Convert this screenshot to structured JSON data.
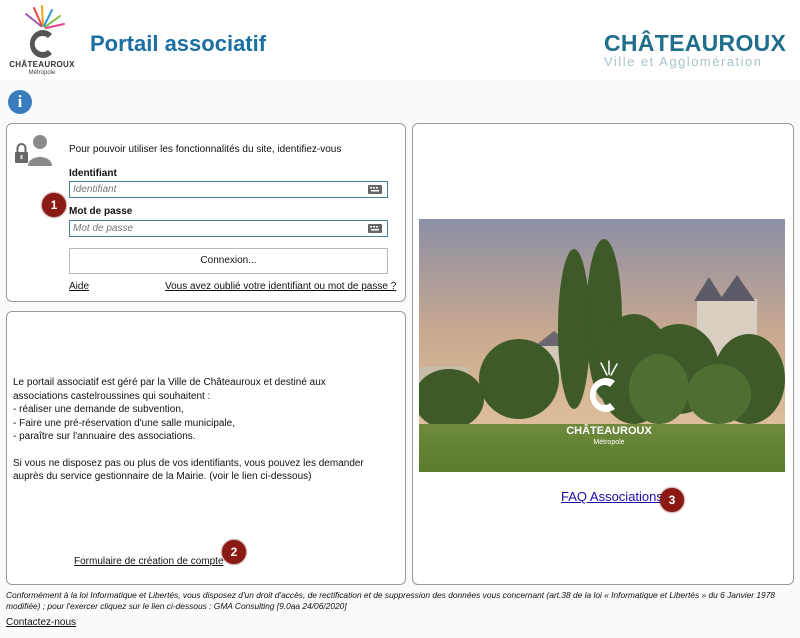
{
  "header": {
    "logo_text": "CHÂTEAUROUX",
    "logo_sub": "Métropole",
    "title": "Portail associatif",
    "brand": "CHÂTEAUROUX",
    "brand_sub": "Ville et Agglomération"
  },
  "info_icon": "i",
  "login": {
    "intro": "Pour pouvoir utiliser les fonctionnalités du site, identifiez-vous",
    "ident_label": "Identifiant",
    "ident_placeholder": "Identifiant",
    "pass_label": "Mot de passe",
    "pass_placeholder": "Mot de passe",
    "connect_label": "Connexion...",
    "help_label": "Aide",
    "forgot_label": "Vous avez oublié votre identifiant ou mot de passe ?"
  },
  "badges": [
    "1",
    "2",
    "3"
  ],
  "description": {
    "line1": "Le portail associatif est géré par la Ville de Châteauroux et destiné aux",
    "line2": "associations castelroussines qui souhaitent :",
    "line3": "- réaliser une demande de subvention,",
    "line4": "- Faire une pré-réservation d'une salle municipale,",
    "line5": "- paraître sur l'annuaire des associations.",
    "line6": "Si vous ne disposez pas ou plus de vos identifiants, vous pouvez les demander",
    "line7": "auprès du service gestionnaire de la Mairie. (voir le lien ci-dessous)"
  },
  "form_link": "Formulaire de création de compte",
  "photo": {
    "logo_text": "CHÂTEAUROUX",
    "logo_sub": "Métropole"
  },
  "faq_link": "FAQ Associations",
  "footer": {
    "note": "Conformément à la loi Informatique et Libertés, vous disposez d'un droit d'accès, de rectification et de suppression des données vous concernant (art.38 de la loi « Informatique et Libertés » du 6 Janvier 1978 modifiée) ; pour l'exercer cliquez sur le lien ci-dessous : GMA Consulting [9.0aa 24/06/2020]",
    "contact": "Contactez-nous"
  },
  "colors": {
    "title_blue": "#1a6fa3",
    "brand_teal": "#1f6e8c",
    "badge_red": "#8b1a14",
    "info_blue": "#3a7dbf",
    "link_blue": "#1a0dab"
  },
  "icons": [
    "chateauroux-logo-icon",
    "info-icon",
    "lock-user-icon",
    "keyboard-icon"
  ]
}
